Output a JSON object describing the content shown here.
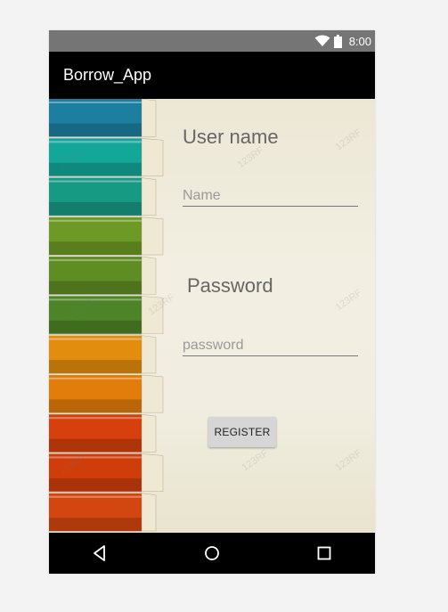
{
  "status_bar": {
    "time": "8:00",
    "icons": [
      "wifi-icon",
      "battery-icon"
    ]
  },
  "app_bar": {
    "title": "Borrow_App"
  },
  "form": {
    "username_label": "User name",
    "username_placeholder": "Name",
    "password_label": "Password",
    "password_placeholder": "password",
    "register_label": "REGISTER"
  },
  "background": {
    "watermark": "123RF",
    "book_colors": [
      "#1c7fa0",
      "#13a79a",
      "#169a83",
      "#6c9a25",
      "#5e8d24",
      "#4d8427",
      "#e38d0e",
      "#e27d0c",
      "#d5400c",
      "#cf3d0b",
      "#d44610"
    ]
  },
  "nav_bar": {
    "icons": [
      "back-icon",
      "home-icon",
      "recents-icon"
    ]
  },
  "colors": {
    "status_bar": "#757575",
    "app_bar": "#000000",
    "page_background": "#f3f3f3",
    "button": "#d6d6d6"
  }
}
